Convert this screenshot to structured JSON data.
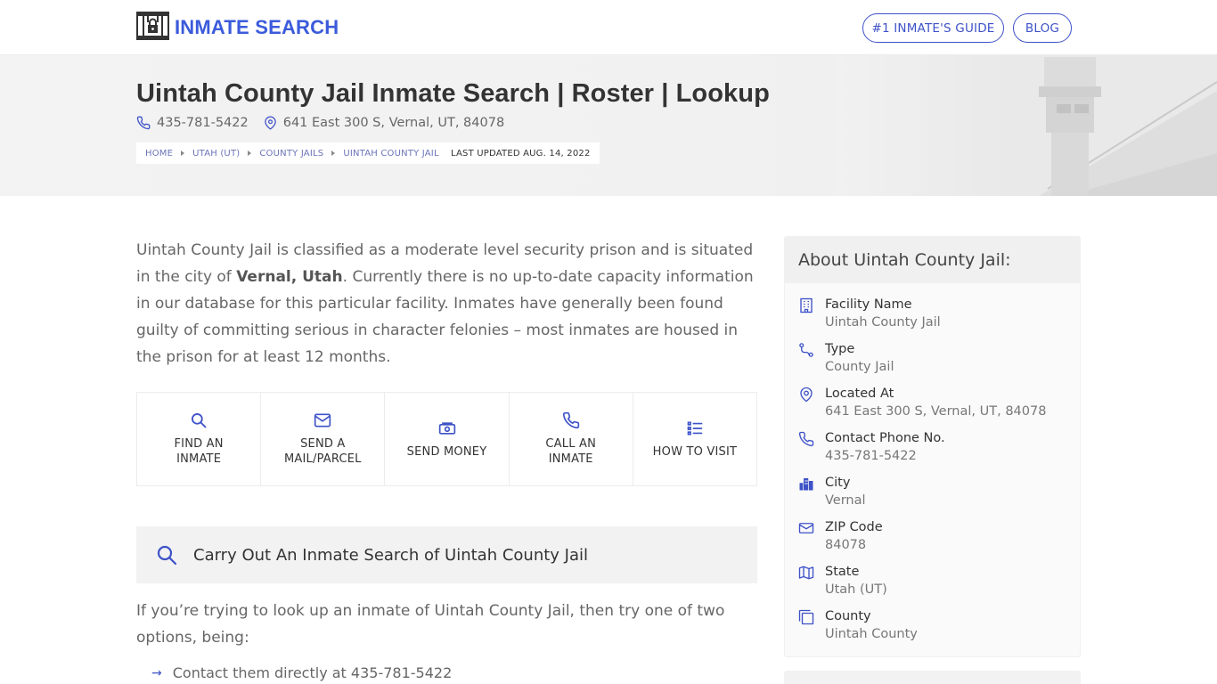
{
  "header": {
    "logo_text": "INMATE SEARCH",
    "nav": [
      {
        "label": "#1 INMATE'S GUIDE"
      },
      {
        "label": "BLOG"
      }
    ]
  },
  "hero": {
    "title": "Uintah County Jail Inmate Search | Roster | Lookup",
    "phone": "435-781-5422",
    "address": "641 East 300 S, Vernal, UT, 84078",
    "breadcrumb": [
      "HOME",
      "UTAH (UT)",
      "COUNTY JAILS",
      "UINTAH COUNTY JAIL"
    ],
    "last_updated": "LAST UPDATED AUG. 14, 2022"
  },
  "intro": {
    "part1": "Uintah County Jail is classified as a moderate level security prison and is situated in the city of ",
    "bold": "Vernal, Utah",
    "part2": ". Currently there is no up-to-date capacity information in our database for this particular facility. Inmates have generally been found guilty of committing serious in character felonies – most inmates are housed in the prison for at least 12 months."
  },
  "actions": [
    {
      "line1": "FIND AN",
      "line2": "INMATE",
      "icon": "search-icon"
    },
    {
      "line1": "SEND A",
      "line2": "MAIL/PARCEL",
      "icon": "mail-icon"
    },
    {
      "line1": "SEND MONEY",
      "line2": "",
      "icon": "money-icon"
    },
    {
      "line1": "CALL AN",
      "line2": "INMATE",
      "icon": "phone-icon"
    },
    {
      "line1": "HOW TO VISIT",
      "line2": "",
      "icon": "list-icon"
    }
  ],
  "search_section": {
    "title": "Carry Out An Inmate Search of Uintah County Jail",
    "paragraph": "If you’re trying to look up an inmate of Uintah County Jail, then try one of two options, being:",
    "bullets": [
      "Contact them directly at 435-781-5422"
    ]
  },
  "sidebar": {
    "title": "About Uintah County Jail:",
    "items": [
      {
        "key": "Facility Name",
        "value": "Uintah County Jail",
        "icon": "building-icon"
      },
      {
        "key": "Type",
        "value": "County Jail",
        "icon": "route-icon"
      },
      {
        "key": "Located At",
        "value": "641 East 300 S, Vernal, UT, 84078",
        "icon": "map-pin-icon"
      },
      {
        "key": "Contact Phone No.",
        "value": "435-781-5422",
        "icon": "phone-icon"
      },
      {
        "key": "City",
        "value": "Vernal",
        "icon": "city-icon"
      },
      {
        "key": "ZIP Code",
        "value": "84078",
        "icon": "mail-icon"
      },
      {
        "key": "State",
        "value": "Utah (UT)",
        "icon": "map-icon"
      },
      {
        "key": "County",
        "value": "Uintah County",
        "icon": "copy-icon"
      }
    ]
  },
  "colors": {
    "accent": "#3e52c8",
    "logo": "#3b5bdb",
    "hero_bg": "#f3f3f3",
    "title_text": "#333333"
  }
}
